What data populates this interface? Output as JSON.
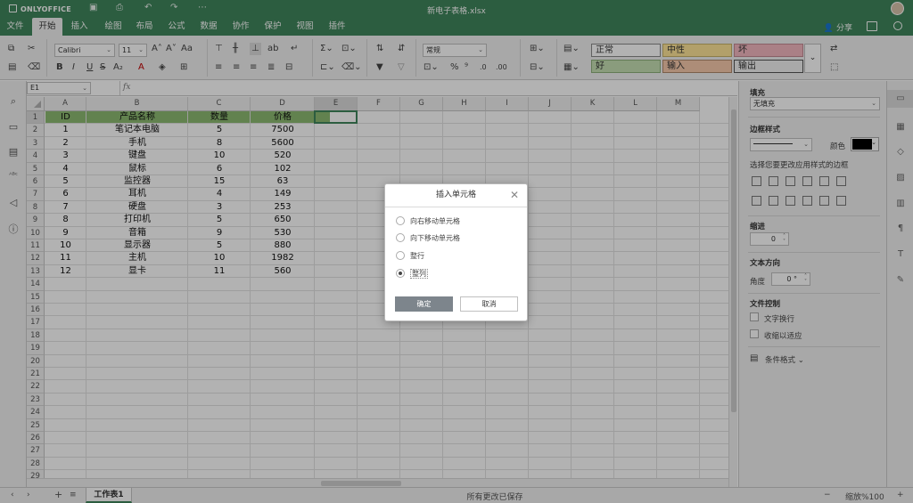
{
  "app": {
    "name": "ONLYOFFICE",
    "document_title": "新电子表格.xlsx"
  },
  "menu": {
    "tabs": [
      "文件",
      "开始",
      "插入",
      "绘图",
      "布局",
      "公式",
      "数据",
      "协作",
      "保护",
      "视图",
      "插件"
    ],
    "active_tab": "开始",
    "share_label": "分享"
  },
  "toolbar": {
    "font_name": "Calibri",
    "font_size": "11",
    "number_format": "常规",
    "styles": [
      {
        "label": "正常",
        "bg": "#ffffff",
        "border": "#8a8a8a"
      },
      {
        "label": "中性",
        "bg": "#ffe699",
        "border": "#c8b46a"
      },
      {
        "label": "坏",
        "bg": "#f4b8c0",
        "border": "#c48a92"
      },
      {
        "label": "好",
        "bg": "#c6e0b4",
        "border": "#8fb07c"
      },
      {
        "label": "输入",
        "bg": "#f8cbad",
        "border": "#b08a6d"
      },
      {
        "label": "输出",
        "bg": "#f2f2f2",
        "border": "#555555"
      }
    ]
  },
  "formula_bar": {
    "name_box": "E1",
    "fx": "fx",
    "value": ""
  },
  "grid": {
    "columns": [
      "A",
      "B",
      "C",
      "D",
      "E",
      "F",
      "G",
      "H",
      "I",
      "J",
      "K",
      "L",
      "M"
    ],
    "row_numbers": [
      "1",
      "2",
      "3",
      "4",
      "5",
      "6",
      "7",
      "8",
      "9",
      "10",
      "11",
      "12",
      "13",
      "14",
      "15",
      "16",
      "17",
      "18",
      "19",
      "20",
      "21",
      "22",
      "23",
      "24",
      "25",
      "26",
      "27",
      "28",
      "29"
    ],
    "header_row": [
      "ID",
      "产品名称",
      "数量",
      "价格"
    ],
    "rows": [
      [
        "1",
        "笔记本电脑",
        "5",
        "7500"
      ],
      [
        "2",
        "手机",
        "8",
        "5600"
      ],
      [
        "3",
        "键盘",
        "10",
        "520"
      ],
      [
        "4",
        "鼠标",
        "6",
        "102"
      ],
      [
        "5",
        "监控器",
        "15",
        "63"
      ],
      [
        "6",
        "耳机",
        "4",
        "149"
      ],
      [
        "7",
        "硬盘",
        "3",
        "253"
      ],
      [
        "8",
        "打印机",
        "5",
        "650"
      ],
      [
        "9",
        "音箱",
        "9",
        "530"
      ],
      [
        "10",
        "显示器",
        "5",
        "880"
      ],
      [
        "11",
        "主机",
        "10",
        "1982"
      ],
      [
        "12",
        "显卡",
        "11",
        "560"
      ]
    ],
    "header_fill": "#8dbb72",
    "selected_cell": "E1"
  },
  "status": {
    "sheet_tab": "工作表1",
    "save_status": "所有更改已保存",
    "zoom": "缩放%100"
  },
  "right_panel": {
    "fill_label": "填充",
    "fill_value": "无填充",
    "border_style_label": "边框样式",
    "color_label": "颜色",
    "border_hint": "选择您要更改应用样式的边框",
    "indent_label": "缩进",
    "indent_value": "0",
    "text_direction_label": "文本方向",
    "angle_label": "角度",
    "angle_value": "0 °",
    "text_control_label": "文件控制",
    "wrap_label": "文字换行",
    "shrink_label": "收缩以适应",
    "cond_format_label": "条件格式"
  },
  "dialog": {
    "title": "插入单元格",
    "options": [
      "向右移动单元格",
      "向下移动单元格",
      "整行",
      "整列"
    ],
    "selected_index": 3,
    "ok_label": "确定",
    "cancel_label": "取消"
  }
}
